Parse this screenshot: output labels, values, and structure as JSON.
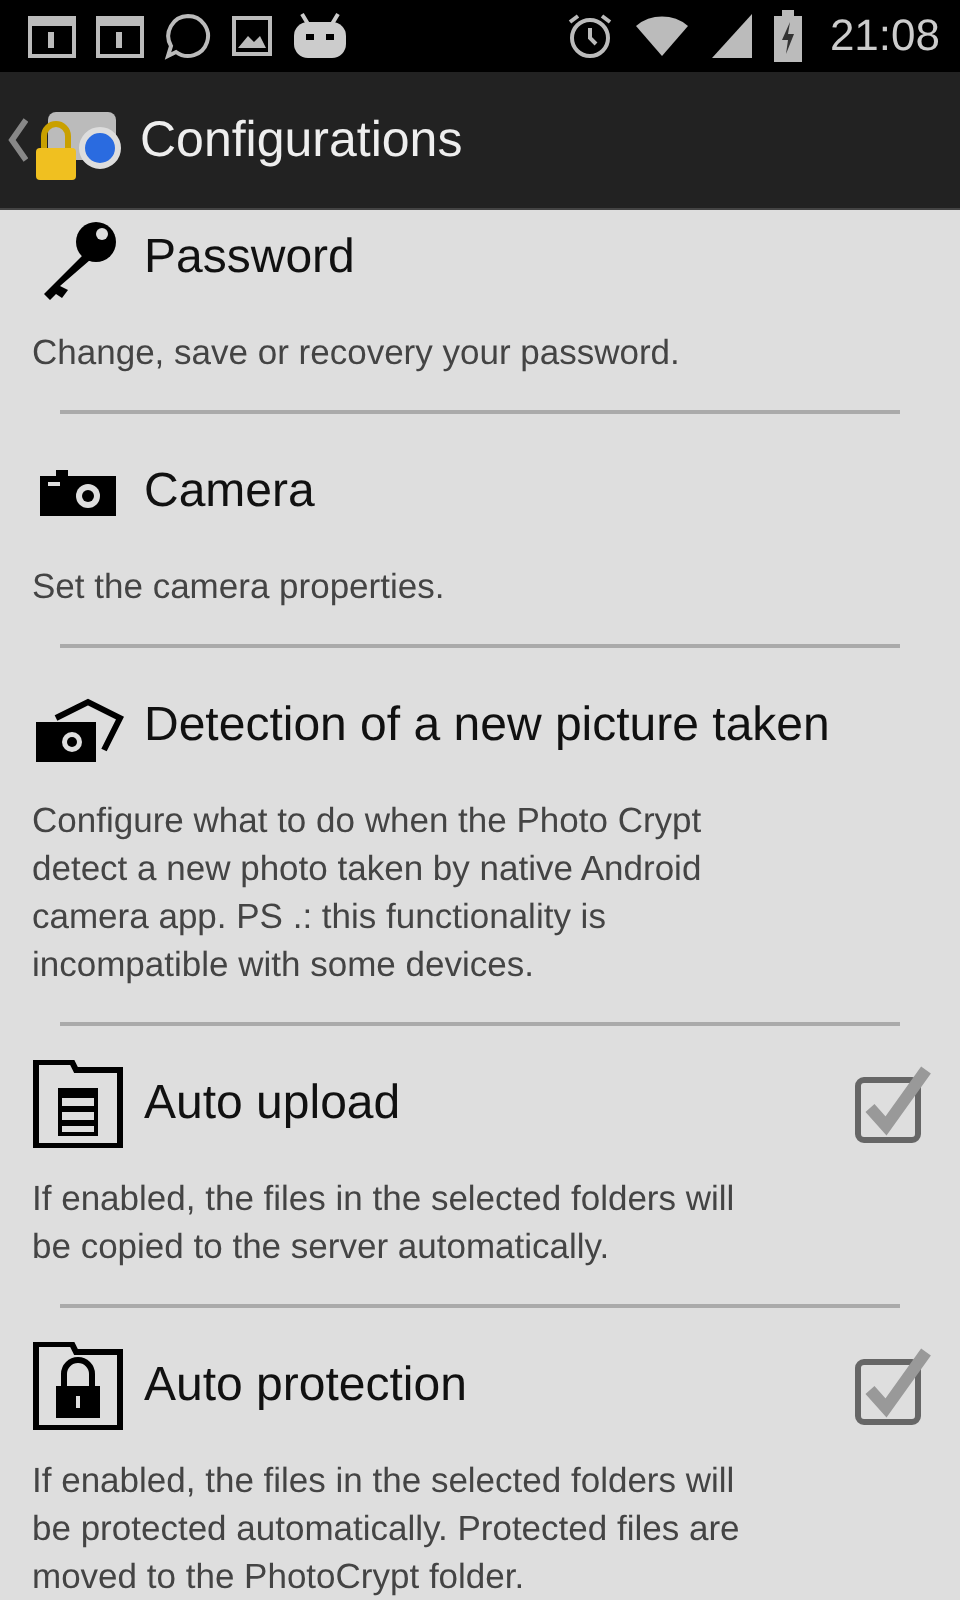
{
  "status_bar": {
    "time": "21:08"
  },
  "action_bar": {
    "title": "Configurations"
  },
  "settings": [
    {
      "kind": "plain",
      "title": "Password",
      "description": [
        "Change, save or recovery your password."
      ]
    },
    {
      "kind": "plain",
      "title": "Camera",
      "description": [
        "Set the camera properties."
      ]
    },
    {
      "kind": "plain",
      "title": "Detection of a new picture taken",
      "description": [
        "Configure what to do when the Photo Crypt",
        "detect a new photo taken by native Android",
        "camera app. PS .: this functionality is",
        "incompatible with some devices."
      ]
    },
    {
      "kind": "checkbox",
      "title": "Auto upload",
      "checked": true,
      "description": [
        "If enabled, the files in the selected folders will",
        "be copied to the server automatically."
      ]
    },
    {
      "kind": "checkbox",
      "title": "Auto protection",
      "checked": true,
      "description": [
        "If enabled, the files in the selected folders will",
        "be protected automatically. Protected files are",
        "moved to the PhotoCrypt folder."
      ]
    }
  ]
}
